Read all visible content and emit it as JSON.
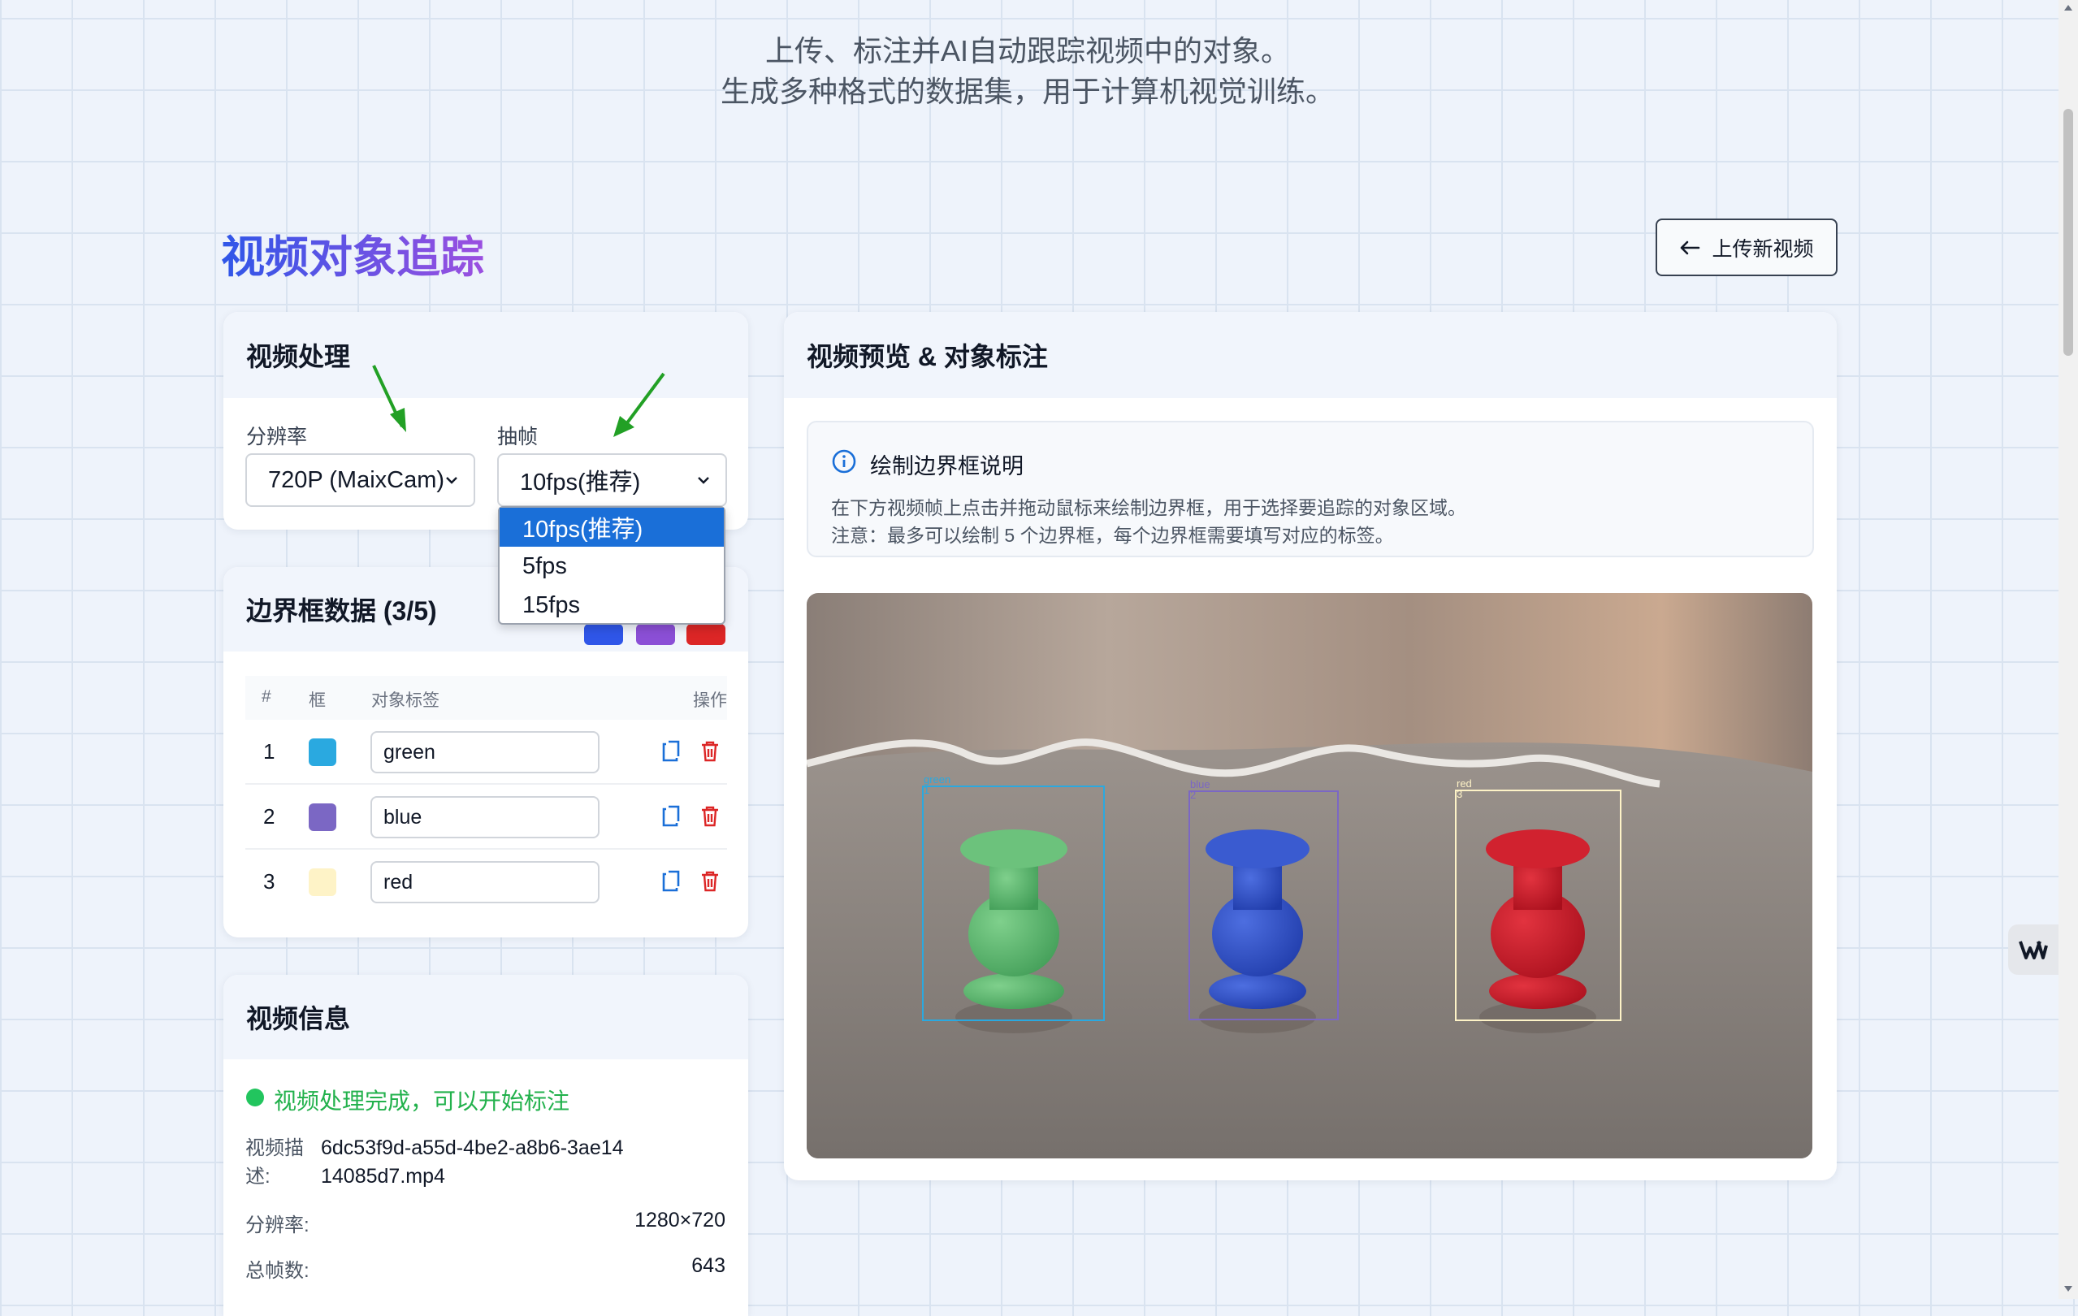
{
  "header": {
    "subtitle_line1": "上传、标注并AI自动跟踪视频中的对象。",
    "subtitle_line2": "生成多种格式的数据集，用于计算机视觉训练。"
  },
  "page": {
    "title": "视频对象追踪",
    "upload_button_label": "上传新视频"
  },
  "processing": {
    "title": "视频处理",
    "resolution_label": "分辨率",
    "resolution_value": "720P (MaixCam)",
    "fps_label": "抽帧",
    "fps_value": "10fps(推荐)",
    "fps_options": [
      "10fps(推荐)",
      "5fps",
      "15fps"
    ],
    "fps_selected_index": 0
  },
  "bbox_data": {
    "title": "边界框数据 (3/5)",
    "columns": [
      "#",
      "框",
      "对象标签",
      "操作"
    ],
    "rows": [
      {
        "index": "1",
        "color": "#2aa9e0",
        "label": "green"
      },
      {
        "index": "2",
        "color": "#7b67c4",
        "label": "blue"
      },
      {
        "index": "3",
        "color": "#fef3c7",
        "label": "red"
      }
    ]
  },
  "video_info": {
    "title": "视频信息",
    "status": "视频处理完成，可以开始标注",
    "status_color": "#22c55e",
    "desc_key": "视频描述:",
    "desc_value": "6dc53f9d-a55d-4be2-a8b6-3ae1414085d7.mp4",
    "resolution_key": "分辨率:",
    "resolution_value": "1280×720",
    "frames_key": "总帧数:",
    "frames_value": "643"
  },
  "preview": {
    "title": "视频预览 & 对象标注",
    "instructions_title": "绘制边界框说明",
    "instructions_line1": "在下方视频帧上点击并拖动鼠标来绘制边界框，用于选择要追踪的对象区域。",
    "instructions_line2": "注意：最多可以绘制 5 个边界框，每个边界框需要填写对应的标签。",
    "boxes": [
      {
        "label": "green",
        "id": "1",
        "color": "#2aa9e0"
      },
      {
        "label": "blue",
        "id": "2",
        "color": "#7b67c4"
      },
      {
        "label": "red",
        "id": "3",
        "color": "#fef3c7"
      }
    ]
  },
  "colors": {
    "accent_blue": "#1a6fd8",
    "delete_red": "#dc2626",
    "arrow_green": "#22a025"
  }
}
